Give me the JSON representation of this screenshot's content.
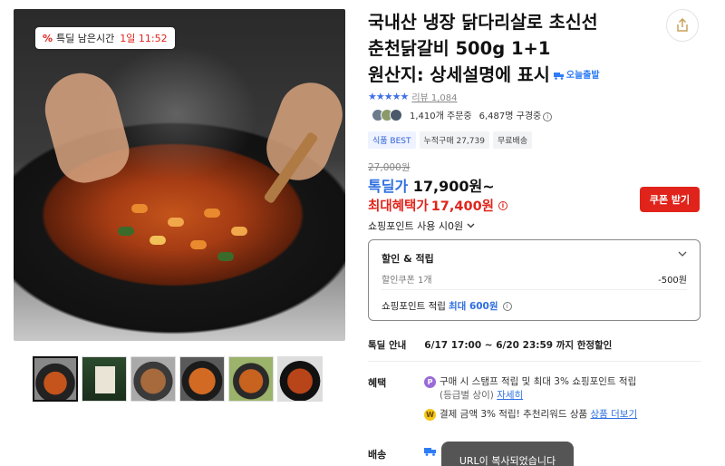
{
  "gallery": {
    "timer_label": "특딜 남은시간",
    "timer_value": "1일 11:52",
    "thumbnails": [
      "thumb-1",
      "thumb-2",
      "thumb-3",
      "thumb-4",
      "thumb-5",
      "thumb-6"
    ]
  },
  "product": {
    "title_lines": [
      "국내산 냉장 닭다리살로 초신선",
      "춘천닭갈비 500g 1+1",
      "원산지: 상세설명에 표시"
    ],
    "today_badge": "오늘출발",
    "rating_stars": "★★★★★",
    "review_text": "리뷰 1,084",
    "orders": "1,410개 주문중",
    "viewers": "6,487명 구경중",
    "tags": [
      "식품 BEST",
      "누적구매 27,739",
      "무료배송"
    ]
  },
  "pricing": {
    "original": "27,000원",
    "deal_label": "톡딜가",
    "deal_price": "17,900원~",
    "benefit_label": "최대혜택가",
    "benefit_price": "17,400원",
    "coupon_button": "쿠폰 받기",
    "points_use": "쇼핑포인트 사용 시0원"
  },
  "discount_box": {
    "title": "할인 & 적립",
    "coupon_label": "할인쿠폰 1개",
    "coupon_value": "-500원",
    "points_label": "쇼핑포인트 적립",
    "points_max": "최대 600원"
  },
  "deal_info": {
    "label": "톡딜 안내",
    "value": "6/17 17:00 ~ 6/20 23:59 까지 한정할인"
  },
  "benefits": {
    "label": "혜택",
    "item1_text": "구매 시 스탬프 적립 및 최대 3% 쇼핑포인트 적립",
    "item1_sub": "(등급별 상이)",
    "item1_link": "자세히",
    "item2_text": "결제 금액 3% 적립! 추천리워드 상품",
    "item2_link": "상품 더보기"
  },
  "shipping": {
    "label": "배송"
  },
  "toast": {
    "message": "URL이 복사되었습니다"
  },
  "colors": {
    "accent_red": "#e0241b",
    "accent_blue": "#2e6fe0"
  }
}
